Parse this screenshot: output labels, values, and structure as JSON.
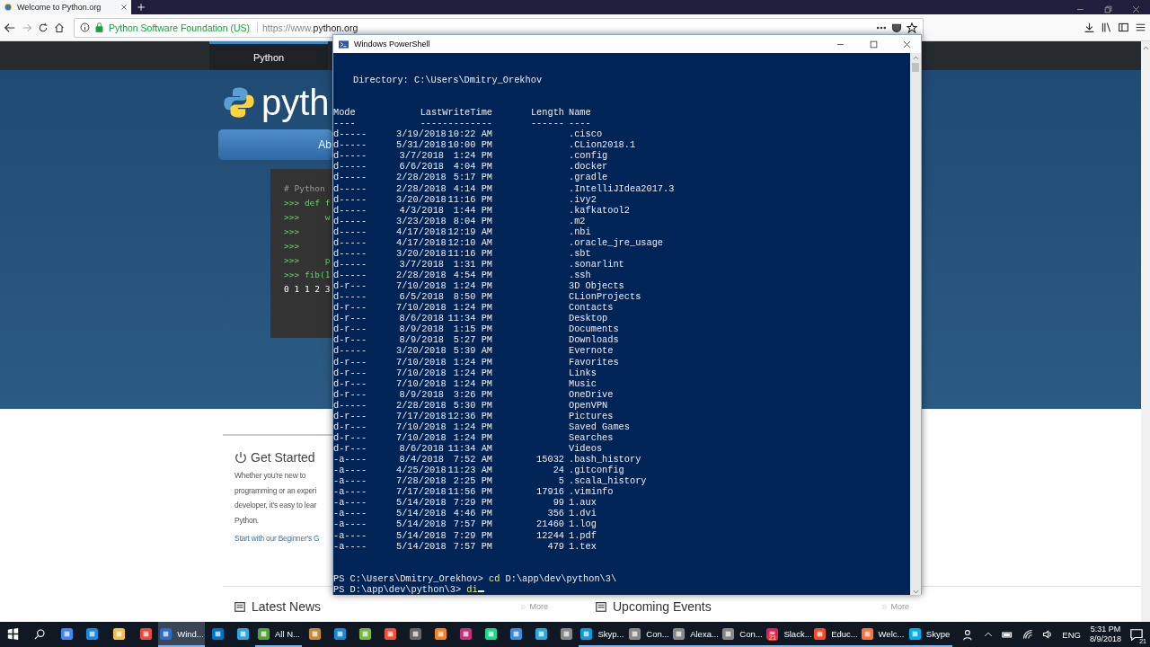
{
  "browser": {
    "tab": {
      "title": "Welcome to Python.org",
      "selected": true
    },
    "address": {
      "identity": "Python Software Foundation (US)",
      "url_prefix": "https://www.",
      "url_domain": "python.org"
    }
  },
  "page": {
    "nav": [
      {
        "label": "Python",
        "selected": true
      }
    ],
    "logo_text": "pyth",
    "hero_button": "Ab",
    "code_lines": [
      {
        "text": "# Python",
        "kind": "comment"
      },
      {
        "text": ">>> def f",
        "kind": "input"
      },
      {
        "text": ">>>     w",
        "kind": "input"
      },
      {
        "text": ">>>",
        "kind": "input"
      },
      {
        "text": ">>>",
        "kind": "input"
      },
      {
        "text": ">>>     p",
        "kind": "input"
      },
      {
        "text": ">>> fib(1",
        "kind": "input"
      },
      {
        "text": "0 1 1 2 3",
        "kind": "output"
      }
    ],
    "get_started": {
      "title": "Get Started",
      "lines": [
        "Whether you're new to",
        "programming or an experi",
        "developer, it's easy to lear",
        "Python."
      ],
      "link": "Start with our Beginner's G"
    },
    "sections": [
      {
        "title": "Latest News",
        "more": "More"
      },
      {
        "title": "Upcoming Events",
        "more": "More"
      }
    ]
  },
  "powershell": {
    "title": "Windows PowerShell",
    "directory": "Directory: C:\\Users\\Dmitry_Orekhov",
    "headers": [
      "Mode",
      "LastWriteTime",
      "Length",
      "Name"
    ],
    "underlines": [
      "----",
      "-------------",
      "------",
      "----"
    ],
    "rows": [
      [
        "d-----",
        "3/19/2018",
        "10:22 AM",
        "",
        ".cisco"
      ],
      [
        "d-----",
        "5/31/2018",
        "10:00 PM",
        "",
        ".CLion2018.1"
      ],
      [
        "d-----",
        "3/7/2018",
        "1:24 PM",
        "",
        ".config"
      ],
      [
        "d-----",
        "6/6/2018",
        "4:04 PM",
        "",
        ".docker"
      ],
      [
        "d-----",
        "2/28/2018",
        "5:17 PM",
        "",
        ".gradle"
      ],
      [
        "d-----",
        "2/28/2018",
        "4:14 PM",
        "",
        ".IntelliJIdea2017.3"
      ],
      [
        "d-----",
        "3/20/2018",
        "11:16 PM",
        "",
        ".ivy2"
      ],
      [
        "d-----",
        "4/3/2018",
        "1:44 PM",
        "",
        ".kafkatool2"
      ],
      [
        "d-----",
        "3/23/2018",
        "8:04 PM",
        "",
        ".m2"
      ],
      [
        "d-----",
        "4/17/2018",
        "12:19 AM",
        "",
        ".nbi"
      ],
      [
        "d-----",
        "4/17/2018",
        "12:10 AM",
        "",
        ".oracle_jre_usage"
      ],
      [
        "d-----",
        "3/20/2018",
        "11:16 PM",
        "",
        ".sbt"
      ],
      [
        "d-----",
        "3/7/2018",
        "1:31 PM",
        "",
        ".sonarlint"
      ],
      [
        "d-----",
        "2/28/2018",
        "4:54 PM",
        "",
        ".ssh"
      ],
      [
        "d-r---",
        "7/10/2018",
        "1:24 PM",
        "",
        "3D Objects"
      ],
      [
        "d-----",
        "6/5/2018",
        "8:50 PM",
        "",
        "CLionProjects"
      ],
      [
        "d-r---",
        "7/10/2018",
        "1:24 PM",
        "",
        "Contacts"
      ],
      [
        "d-r---",
        "8/6/2018",
        "11:34 PM",
        "",
        "Desktop"
      ],
      [
        "d-r---",
        "8/9/2018",
        "1:15 PM",
        "",
        "Documents"
      ],
      [
        "d-r---",
        "8/9/2018",
        "5:27 PM",
        "",
        "Downloads"
      ],
      [
        "d-----",
        "3/20/2018",
        "5:39 AM",
        "",
        "Evernote"
      ],
      [
        "d-r---",
        "7/10/2018",
        "1:24 PM",
        "",
        "Favorites"
      ],
      [
        "d-r---",
        "7/10/2018",
        "1:24 PM",
        "",
        "Links"
      ],
      [
        "d-r---",
        "7/10/2018",
        "1:24 PM",
        "",
        "Music"
      ],
      [
        "d-r---",
        "8/9/2018",
        "3:26 PM",
        "",
        "OneDrive"
      ],
      [
        "d-----",
        "2/28/2018",
        "5:30 PM",
        "",
        "OpenVPN"
      ],
      [
        "d-r---",
        "7/17/2018",
        "12:36 PM",
        "",
        "Pictures"
      ],
      [
        "d-r---",
        "7/10/2018",
        "1:24 PM",
        "",
        "Saved Games"
      ],
      [
        "d-r---",
        "7/10/2018",
        "1:24 PM",
        "",
        "Searches"
      ],
      [
        "d-r---",
        "8/6/2018",
        "11:34 AM",
        "",
        "Videos"
      ],
      [
        "-a----",
        "8/4/2018",
        "7:52 AM",
        "15032",
        ".bash_history"
      ],
      [
        "-a----",
        "4/25/2018",
        "11:23 AM",
        "24",
        ".gitconfig"
      ],
      [
        "-a----",
        "7/28/2018",
        "2:25 PM",
        "5",
        ".scala_history"
      ],
      [
        "-a----",
        "7/17/2018",
        "11:56 PM",
        "17916",
        ".viminfo"
      ],
      [
        "-a----",
        "5/14/2018",
        "7:29 PM",
        "99",
        "1.aux"
      ],
      [
        "-a----",
        "5/14/2018",
        "4:46 PM",
        "356",
        "1.dvi"
      ],
      [
        "-a----",
        "5/14/2018",
        "7:57 PM",
        "21460",
        "1.log"
      ],
      [
        "-a----",
        "5/14/2018",
        "7:29 PM",
        "12244",
        "1.pdf"
      ],
      [
        "-a----",
        "5/14/2018",
        "7:57 PM",
        "479",
        "1.tex"
      ]
    ],
    "prompts": [
      {
        "prompt": "PS C:\\Users\\Dmitry_Orekhov>",
        "command": "cd",
        "argument": "D:\\app\\dev\\python\\3\\"
      },
      {
        "prompt": "PS D:\\app\\dev\\python\\3>",
        "command": "di"
      }
    ]
  },
  "taskbar": {
    "apps": [
      {
        "running": false,
        "selected": false
      },
      {
        "running": false,
        "selected": false
      },
      {
        "running": false,
        "selected": false
      },
      {
        "running": false,
        "selected": false
      },
      {
        "label": "Wind...",
        "running": true,
        "selected": true
      },
      {
        "running": false,
        "selected": false
      },
      {
        "running": false,
        "selected": false
      },
      {
        "label": "All N...",
        "running": true,
        "selected": false
      },
      {
        "running": false,
        "selected": false
      },
      {
        "running": false,
        "selected": false
      },
      {
        "running": false,
        "selected": false
      },
      {
        "running": false,
        "selected": false
      },
      {
        "running": false,
        "selected": false
      },
      {
        "running": false,
        "selected": false
      },
      {
        "running": false,
        "selected": false
      },
      {
        "running": false,
        "selected": false
      },
      {
        "running": false,
        "selected": false
      },
      {
        "running": false,
        "selected": false
      },
      {
        "running": false,
        "selected": false
      },
      {
        "label": "Skyp...",
        "running": true,
        "selected": false
      },
      {
        "label": "Con...",
        "running": true,
        "selected": false
      },
      {
        "label": "Alexa...",
        "running": true,
        "selected": false
      },
      {
        "label": "Con...",
        "running": true,
        "selected": false
      },
      {
        "label": "Slack...",
        "running": true,
        "selected": false,
        "badge": "21"
      },
      {
        "label": "Educ...",
        "running": true,
        "selected": false
      },
      {
        "label": "Welc...",
        "running": true,
        "selected": false
      },
      {
        "label": "Skype",
        "running": true,
        "selected": false
      }
    ],
    "language": "ENG",
    "time": "5:31 PM",
    "date": "8/9/2018",
    "notifications": "21"
  }
}
